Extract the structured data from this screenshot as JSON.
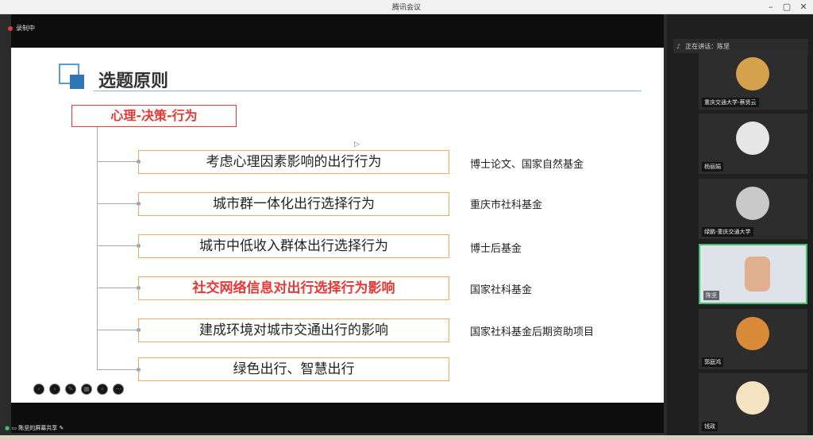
{
  "app": {
    "title": "腾讯会议"
  },
  "status": {
    "recording": "录制中",
    "speaking": "正在讲话：陈坚",
    "screen_share": "陈坚的屏幕共享"
  },
  "slide": {
    "title": "选题原则",
    "category": "心理-决策-行为",
    "items": [
      {
        "topic": "考虑心理因素影响的出行行为",
        "fund": "博士论文、国家自然基金"
      },
      {
        "topic": "城市群一体化出行选择行为",
        "fund": "重庆市社科基金"
      },
      {
        "topic": "城市中低收入群体出行选择行为",
        "fund": "博士后基金"
      },
      {
        "topic": "社交网络信息对出行选择行为影响",
        "fund": "国家社科基金"
      },
      {
        "topic": "建成环境对城市交通出行的影响",
        "fund": "国家社科基金后期资助项目"
      },
      {
        "topic": "绿色出行、智慧出行",
        "fund": ""
      }
    ]
  },
  "participants": [
    {
      "name": "重庆交通大学-蔡贤云"
    },
    {
      "name": "杨丽娟"
    },
    {
      "name": "绿鹏-重庆交通大学"
    },
    {
      "name": "陈坚"
    },
    {
      "name": "郭庭鸿"
    },
    {
      "name": "钱政"
    }
  ],
  "colors": {
    "accent_red": "#e53935",
    "accent_blue": "#2e75b6",
    "box_orange": "#f2a766",
    "active_green": "#3fbf6f"
  }
}
